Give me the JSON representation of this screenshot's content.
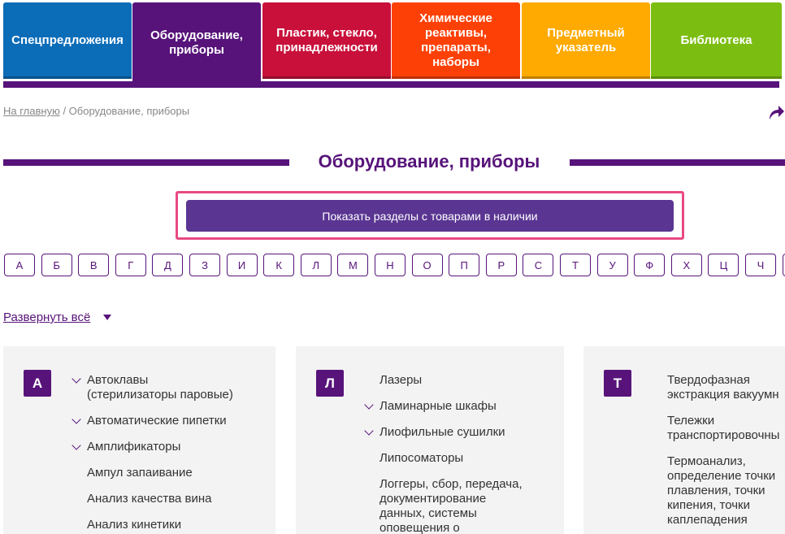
{
  "tabs": [
    {
      "label": "Спецпредложения",
      "color": "#0b6cb8"
    },
    {
      "label": "Оборудование, приборы",
      "color": "#57137a"
    },
    {
      "label": "Пластик, стекло, принадлежности",
      "color": "#c8103a"
    },
    {
      "label": "Химические реактивы, препараты, наборы",
      "color": "#fd4106"
    },
    {
      "label": "Предметный указатель",
      "color": "#ffaa00"
    },
    {
      "label": "Библиотека",
      "color": "#7cbd12"
    }
  ],
  "breadcrumb": {
    "home": "На главную",
    "current": " / Оборудование, приборы"
  },
  "page_title": "Оборудование, приборы",
  "show_button": "Показать разделы с товарами в наличии",
  "alphabet": [
    "А",
    "Б",
    "В",
    "Г",
    "Д",
    "З",
    "И",
    "К",
    "Л",
    "М",
    "Н",
    "О",
    "П",
    "Р",
    "С",
    "Т",
    "У",
    "Ф",
    "Х",
    "Ц",
    "Ч"
  ],
  "expand_all": "Развернуть всё",
  "columns": [
    {
      "letter": "А",
      "items": [
        {
          "line1": "Автоклавы",
          "line2": "(стерилизаторы паровые)",
          "expandable": true
        },
        {
          "line1": "Автоматические пипетки",
          "expandable": true
        },
        {
          "line1": "Амплификаторы",
          "expandable": true
        },
        {
          "line1": "Ампул запаивание",
          "expandable": false
        },
        {
          "line1": "Анализ качества вина",
          "expandable": false
        },
        {
          "line1": "Анализ кинетики",
          "expandable": false
        }
      ]
    },
    {
      "letter": "Л",
      "items": [
        {
          "line1": "Лазеры",
          "expandable": false
        },
        {
          "line1": "Ламинарные шкафы",
          "expandable": true
        },
        {
          "line1": "Лиофильные сушилки",
          "expandable": true
        },
        {
          "line1": "Липосоматоры",
          "expandable": false
        },
        {
          "line1": "Логгеры, сбор, передача,",
          "line2": "документирование",
          "line3": "данных, системы",
          "line4": "оповещения о",
          "expandable": false
        }
      ]
    },
    {
      "letter": "Т",
      "items": [
        {
          "line1": "Твердофазная",
          "line2": "экстракция вакуумн",
          "expandable": false
        },
        {
          "line1": "Тележки",
          "line2": "транспортировочны",
          "expandable": false
        },
        {
          "line1": "Термоанализ,",
          "line2": "определение точки",
          "line3": "плавления, точки",
          "line4": "кипения, точки",
          "line5": "каплепадения",
          "expandable": false
        }
      ]
    }
  ]
}
